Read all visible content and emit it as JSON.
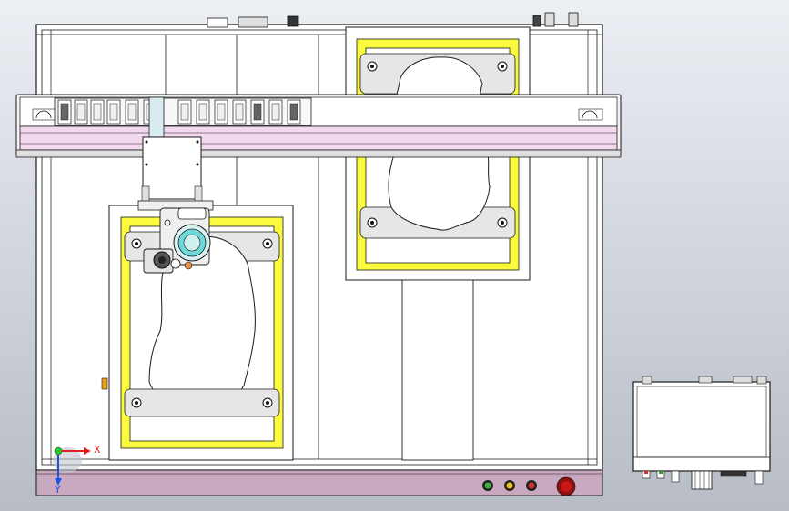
{
  "viewport": {
    "background": "gradient-gray"
  },
  "colors": {
    "frame_stroke": "#1a1a1a",
    "panel_white": "#ffffff",
    "plate_yellow": "#fbfa3c",
    "gantry_pink": "#f3d9f0",
    "base_panel": "#c9a9bf",
    "clamp_gray": "#e6e6e6",
    "x_axis": "#e02020",
    "y_axis": "#2050e0",
    "z_axis": "#30c030",
    "lamp_green": "#3cb43c",
    "lamp_yellow": "#e8c020",
    "lamp_red": "#d03030",
    "estop_red": "#c81818",
    "head_cyan": "#6fd8d8"
  },
  "triad": {
    "x_label": "X",
    "y_label": "Y"
  },
  "indicators": [
    "lamp_green",
    "lamp_yellow",
    "lamp_red",
    "estop_red"
  ]
}
